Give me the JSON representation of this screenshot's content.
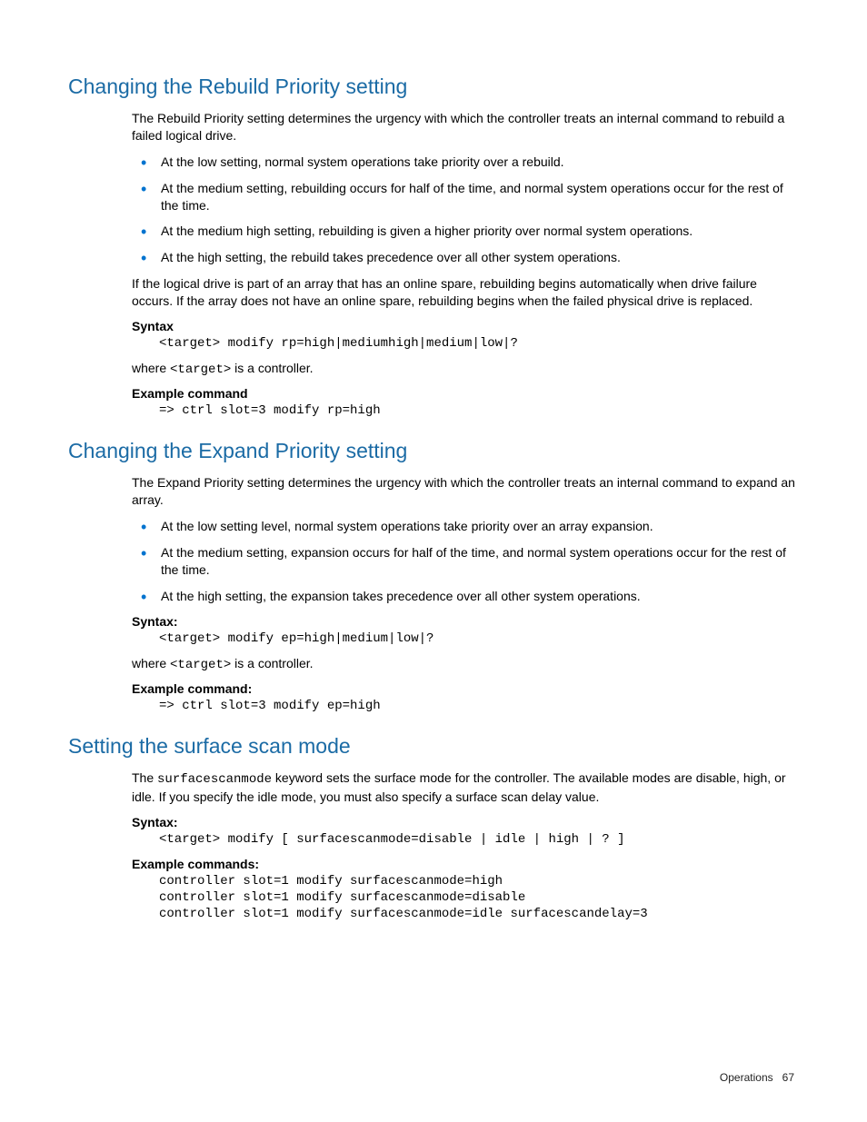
{
  "sections": [
    {
      "heading": "Changing the Rebuild Priority setting",
      "intro": "The Rebuild Priority setting determines the urgency with which the controller treats an internal command to rebuild a failed logical drive.",
      "bullets": [
        "At the low setting, normal system operations take priority over a rebuild.",
        "At the medium setting, rebuilding occurs for half of the time, and normal system operations occur for the rest of the time.",
        "At the medium high setting, rebuilding is given a higher priority over normal system operations.",
        "At the high setting, the rebuild takes precedence over all other system operations."
      ],
      "after": "If the logical drive is part of an array that has an online spare, rebuilding begins automatically when drive failure occurs. If the array does not have an online spare, rebuilding begins when the failed physical drive is replaced.",
      "syntax_label": "Syntax",
      "syntax_code": "<target> modify rp=high|mediumhigh|medium|low|?",
      "where_prefix": "where ",
      "where_code": "<target>",
      "where_suffix": " is a controller.",
      "example_label": "Example command",
      "example_code": "=> ctrl slot=3 modify rp=high"
    },
    {
      "heading": "Changing the Expand Priority setting",
      "intro": "The Expand Priority setting determines the urgency with which the controller treats an internal command to expand an array.",
      "bullets": [
        "At the low setting level, normal system operations take priority over an array expansion.",
        "At the medium setting, expansion occurs for half of the time, and normal system operations occur for the rest of the time.",
        "At the high setting, the expansion takes precedence over all other system operations."
      ],
      "syntax_label": "Syntax:",
      "syntax_code": "<target> modify ep=high|medium|low|?",
      "where_prefix": "where ",
      "where_code": "<target>",
      "where_suffix": " is a controller.",
      "example_label": "Example command:",
      "example_code": "=> ctrl slot=3 modify ep=high"
    },
    {
      "heading": "Setting the surface scan mode",
      "intro_prefix": "The ",
      "intro_code": "surfacescanmode",
      "intro_suffix": " keyword sets the surface mode for the controller. The available modes are disable, high, or idle. If you specify the idle mode, you must also specify a surface scan delay value.",
      "syntax_label": "Syntax:",
      "syntax_code": "<target> modify [ surfacescanmode=disable | idle | high | ? ]",
      "example_label": "Example commands:",
      "example_code": "controller slot=1 modify surfacescanmode=high\ncontroller slot=1 modify surfacescanmode=disable\ncontroller slot=1 modify surfacescanmode=idle surfacescandelay=3"
    }
  ],
  "footer": {
    "section": "Operations",
    "page": "67"
  }
}
